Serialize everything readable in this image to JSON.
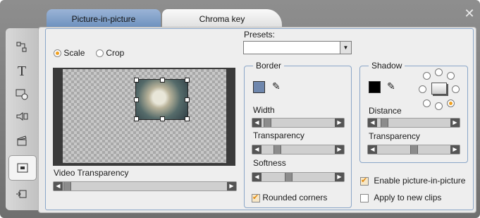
{
  "tabs": [
    {
      "label": "Picture-in-picture",
      "active": true
    },
    {
      "label": "Chroma key",
      "active": false
    }
  ],
  "close_label": "✕",
  "rail": {
    "items": [
      "layout-icon",
      "text-icon",
      "clip-icon",
      "audio-icon",
      "clapper-icon",
      "pip-icon",
      "export-icon"
    ],
    "active_index": 5
  },
  "mode": {
    "scale_label": "Scale",
    "crop_label": "Crop",
    "selected": "Scale"
  },
  "video_transparency": {
    "label": "Video Transparency",
    "value": 0.02
  },
  "presets": {
    "label": "Presets:",
    "value": ""
  },
  "border": {
    "title": "Border",
    "width_label": "Width",
    "width_value": 0.03,
    "transparency_label": "Transparency",
    "transparency_value": 0.12,
    "softness_label": "Softness",
    "softness_value": 0.33,
    "color": "#6f87ad",
    "rounded_label": "Rounded corners",
    "rounded_checked": true
  },
  "shadow": {
    "title": "Shadow",
    "color": "#000000",
    "distance_label": "Distance",
    "distance_value": 0.08,
    "transparency_label": "Transparency",
    "transparency_value": 0.5,
    "direction_selected": "bottom-right"
  },
  "options": {
    "enable_label": "Enable picture-in-picture",
    "enable_checked": true,
    "apply_label": "Apply to new clips",
    "apply_checked": false
  },
  "colors": {
    "accent": "#f0a020",
    "tab_active": "#7c9cc6",
    "group_border": "#8aa6c8"
  }
}
